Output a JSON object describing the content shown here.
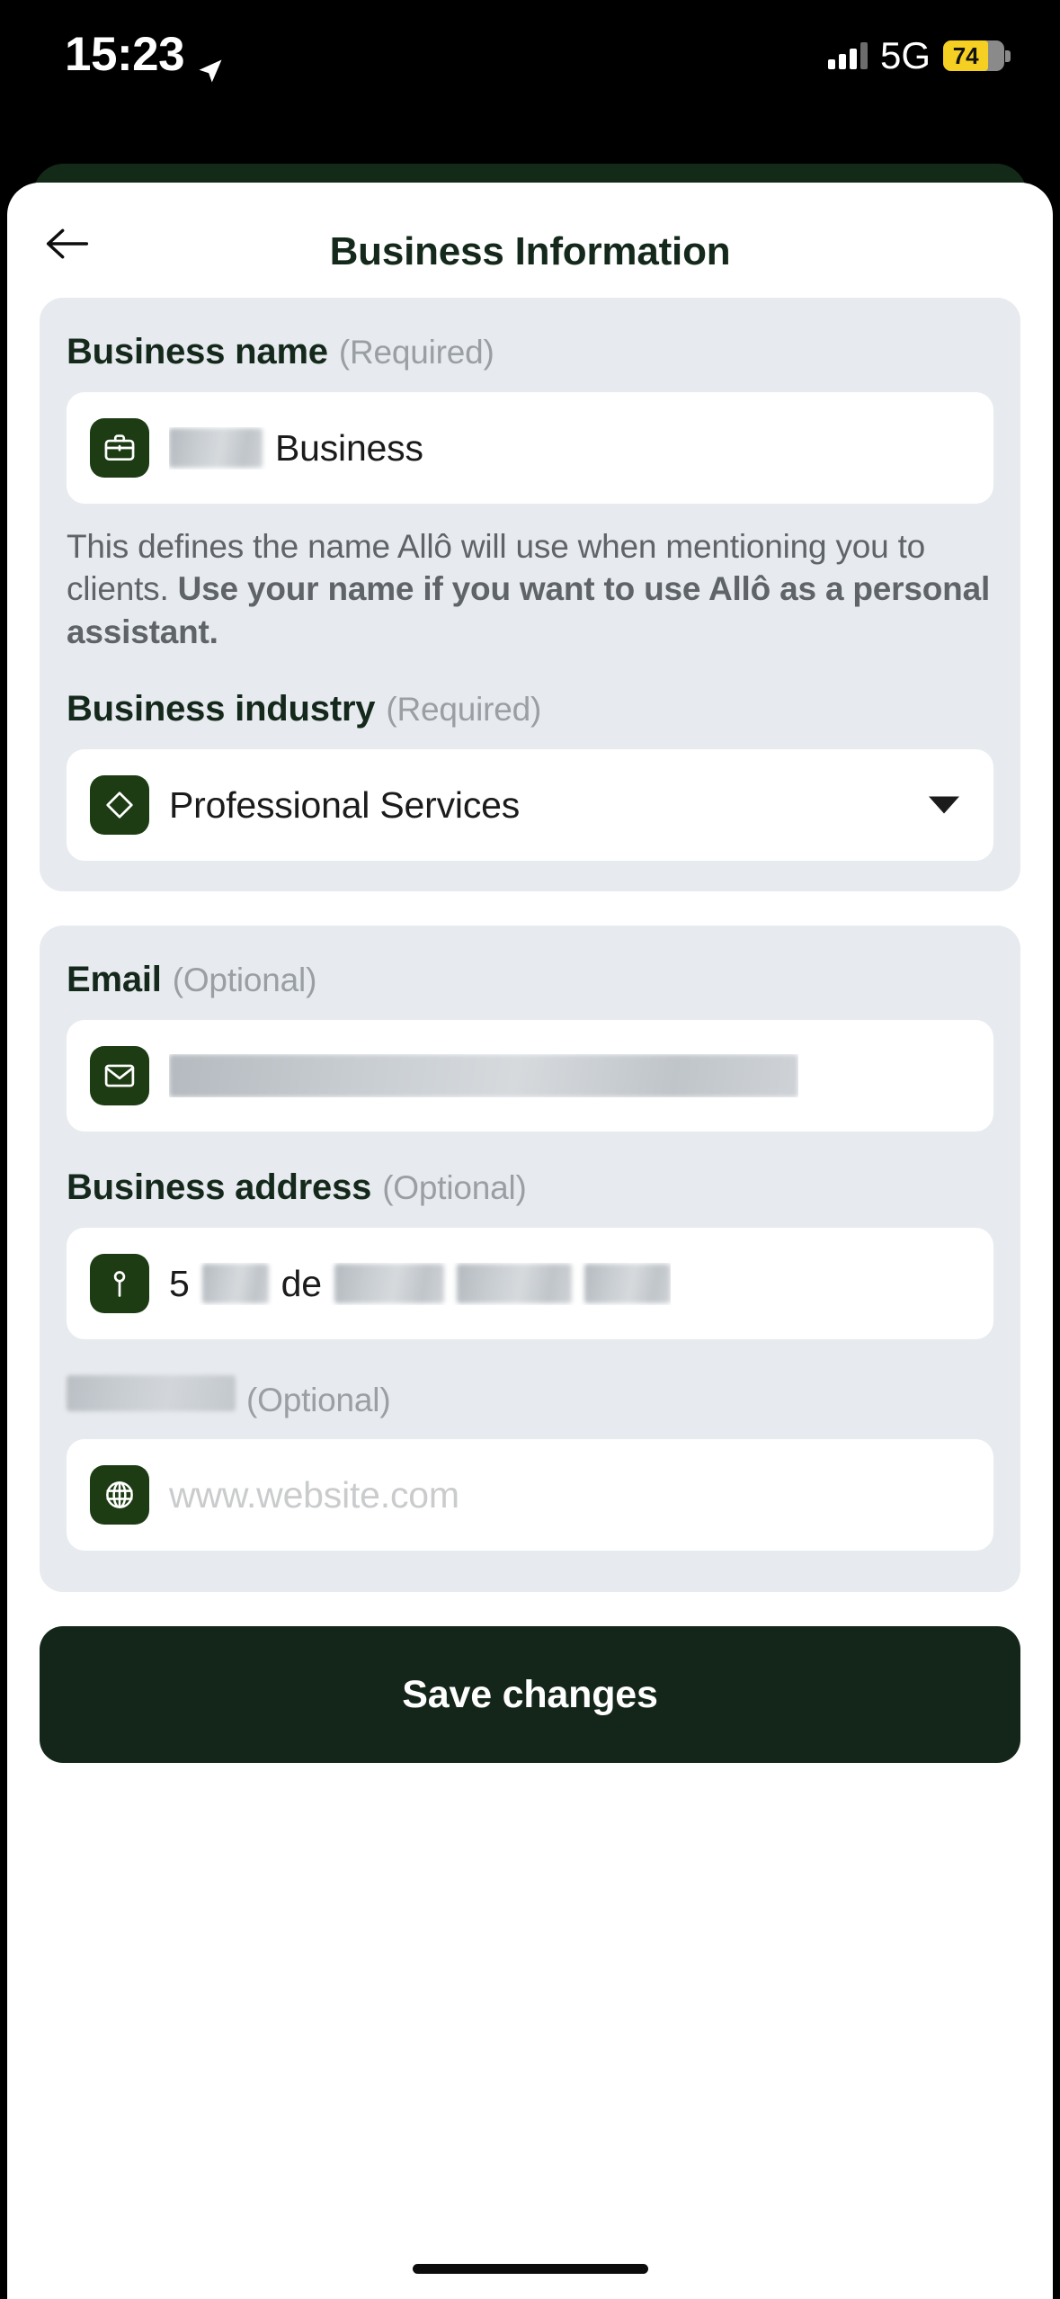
{
  "status_bar": {
    "time": "15:23",
    "location_icon": "location-arrow-icon",
    "signal_icon": "cellular-bars-icon",
    "network": "5G",
    "battery_level": "74",
    "battery_color": "#f5cf22"
  },
  "header": {
    "back_icon": "back-arrow-icon",
    "title": "Business Information"
  },
  "theme": {
    "accent_dark_green": "#142619",
    "icon_green": "#1d3c14",
    "card_bg": "#e7eaee",
    "label_color": "#14291b",
    "muted_color": "#9a9fa4"
  },
  "section_business": {
    "name": {
      "label": "Business name",
      "requirement": "(Required)",
      "icon": "briefcase-icon",
      "value_redacted": true,
      "value_suffix": "Business",
      "helper_text_regular": "This defines the name Allô will use when mentioning you to clients. ",
      "helper_text_bold": "Use your name if you want to use Allô as a personal assistant."
    },
    "industry": {
      "label": "Business industry",
      "requirement": "(Required)",
      "icon": "diamond-icon",
      "value": "Professional Services",
      "dropdown_icon": "caret-down-icon"
    }
  },
  "section_contact": {
    "email": {
      "label": "Email",
      "requirement": "(Optional)",
      "icon": "envelope-icon",
      "value_redacted": true
    },
    "address": {
      "label": "Business address",
      "requirement": "(Optional)",
      "icon": "location-pin-icon",
      "value_part_1": "5",
      "value_part_2": "de",
      "value_redacted": true
    },
    "website": {
      "label_redacted": true,
      "requirement": "(Optional)",
      "icon": "globe-icon",
      "placeholder": "www.website.com",
      "value": ""
    }
  },
  "footer": {
    "save_label": "Save changes"
  }
}
